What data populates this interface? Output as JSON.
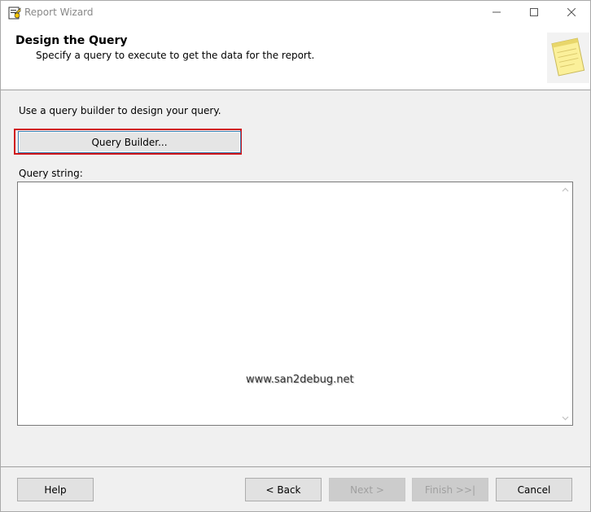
{
  "window": {
    "title": "Report Wizard",
    "controls": [
      "minimize-icon",
      "maximize-icon",
      "close-icon"
    ]
  },
  "header": {
    "title": "Design the Query",
    "subtitle": "Specify a query to execute to get the data for the report.",
    "icon": "notepad-icon"
  },
  "main": {
    "intro": "Use a query builder to design your query.",
    "query_builder_label": "Query Builder...",
    "query_string_label": "Query string:",
    "query_string_value": "",
    "watermark": "www.san2debug.net"
  },
  "footer": {
    "help_label": "Help",
    "back_label": "< Back",
    "next_label": "Next >",
    "finish_label": "Finish >>|",
    "cancel_label": "Cancel"
  },
  "colors": {
    "highlight": "#d0171b",
    "focus_border": "#3c7fb1",
    "dialog_bg": "#f0f0f0"
  }
}
